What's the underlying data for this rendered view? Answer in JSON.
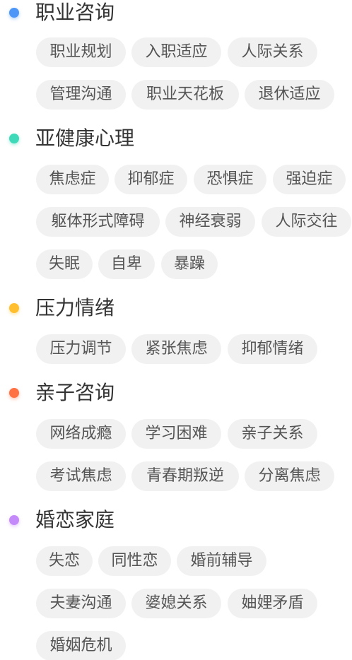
{
  "colors": {
    "career": "#4d96f7",
    "subhealth": "#3ed9b8",
    "stress": "#ffbf2e",
    "parenting": "#ff7043",
    "marriage": "#c58af9"
  },
  "sections": [
    {
      "title": "职业咨询",
      "dot_color": "#4d96f7",
      "tags": [
        "职业规划",
        "入职适应",
        "人际关系",
        "管理沟通",
        "职业天花板",
        "退休适应"
      ]
    },
    {
      "title": "亚健康心理",
      "dot_color": "#3ed9b8",
      "tags": [
        "焦虑症",
        "抑郁症",
        "恐惧症",
        "强迫症",
        "躯体形式障碍",
        "神经衰弱",
        "人际交往",
        "失眠",
        "自卑",
        "暴躁"
      ]
    },
    {
      "title": "压力情绪",
      "dot_color": "#ffbf2e",
      "tags": [
        "压力调节",
        "紧张焦虑",
        "抑郁情绪"
      ]
    },
    {
      "title": "亲子咨询",
      "dot_color": "#ff7043",
      "tags": [
        "网络成瘾",
        "学习困难",
        "亲子关系",
        "考试焦虑",
        "青春期叛逆",
        "分离焦虑"
      ]
    },
    {
      "title": "婚恋家庭",
      "dot_color": "#c58af9",
      "tags": [
        "失恋",
        "同性恋",
        "婚前辅导",
        "夫妻沟通",
        "婆媳关系",
        "妯娌矛盾",
        "婚姻危机"
      ]
    }
  ]
}
